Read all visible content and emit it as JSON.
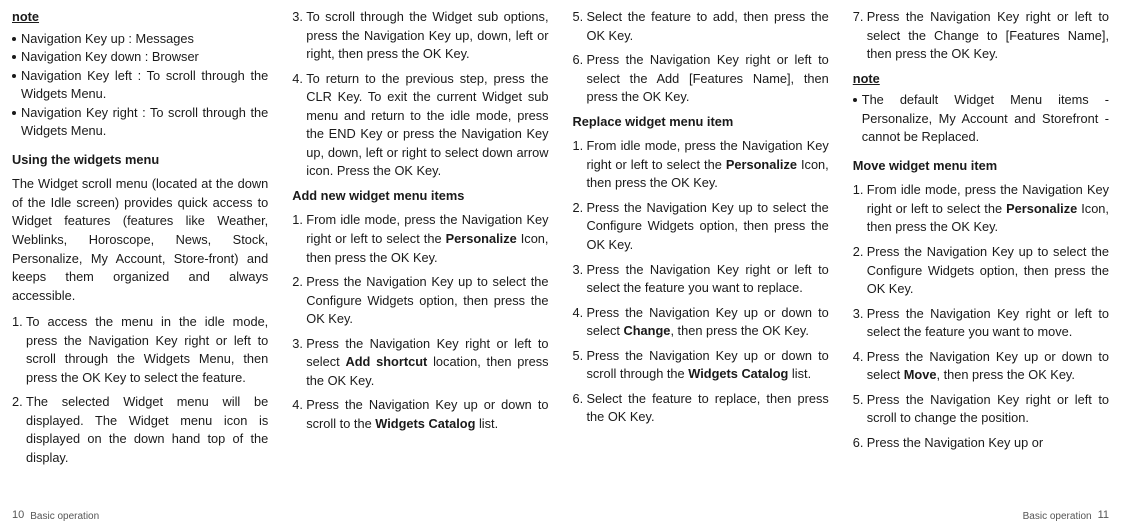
{
  "col1": {
    "note_heading": "note",
    "note_items": [
      "Navigation Key up : Messages",
      "Navigation Key down : Browser",
      "Navigation Key left : To scroll through the Widgets Menu.",
      "Navigation Key right : To scroll through the Widgets Menu."
    ],
    "sec_heading": "Using the widgets menu",
    "para": "The Widget scroll menu (located at the down of the Idle screen) provides quick access to Widget features (features like Weather, Weblinks, Horoscope, News, Stock, Personalize, My Account, Store-front) and keeps them organized and always accessible.",
    "steps": [
      "To access the menu in the idle mode, press the Navigation Key right or left to scroll through the Widgets Menu, then press the OK Key to select the feature.",
      "The selected Widget menu will be displayed. The Widget menu icon is displayed on the down hand top of the display."
    ],
    "footer_label": "Basic operation",
    "footer_num": "10"
  },
  "col2": {
    "top_steps": [
      "To scroll through the Widget sub options, press the Navigation Key up, down, left or right, then press the OK Key.",
      "To return to the previous step, press the CLR Key. To exit the current Widget sub menu and return to the idle mode, press the END Key or press the Navigation Key up, down, left or right to select down arrow icon. Press the OK Key."
    ],
    "sec_heading": "Add new widget menu items",
    "add_steps": {
      "s1a": "From idle mode, press the Navigation Key right or left to select the ",
      "s1b": "Personalize",
      "s1c": " Icon, then press the OK Key.",
      "s2": "Press the Navigation Key up to select the Configure Widgets option, then press the OK Key.",
      "s3a": "Press the Navigation Key right or left to select ",
      "s3b": "Add shortcut",
      "s3c": " location, then press the OK Key.",
      "s4a": "Press the Navigation Key up or down to scroll to the ",
      "s4b": "Widgets Catalog",
      "s4c": " list."
    }
  },
  "col3": {
    "top_steps": [
      "Select the feature to add, then press the OK Key.",
      "Press the Navigation Key right or left to select the Add [Features Name], then press the OK Key."
    ],
    "sec_heading": "Replace widget menu item",
    "rep_steps": {
      "s1a": "From idle mode, press the Navigation Key right or left to select the ",
      "s1b": "Personalize",
      "s1c": " Icon, then press the OK Key.",
      "s2": "Press the Navigation Key up to select the Configure Widgets option, then press the OK Key.",
      "s3": "Press the Navigation Key right or left to select the feature you want to replace.",
      "s4a": "Press the Navigation Key up or down to select ",
      "s4b": "Change",
      "s4c": ", then press the OK Key.",
      "s5a": "Press the Navigation Key up or down to scroll through the ",
      "s5b": "Widgets Catalog",
      "s5c": " list.",
      "s6": "Select the feature to replace, then press the OK Key."
    }
  },
  "col4": {
    "top_step": "Press the Navigation Key right or left to select the Change to [Features Name], then press the OK Key.",
    "note_heading": "note",
    "note_item": "The default Widget Menu items - Personalize, My Account and Storefront - cannot be Replaced.",
    "sec_heading": "Move widget menu item",
    "mov_steps": {
      "s1a": "From idle mode, press the Navigation Key right or left to select the ",
      "s1b": "Personalize",
      "s1c": " Icon, then press the OK Key.",
      "s2": "Press the Navigation Key up to select the Configure Widgets option, then press the OK Key.",
      "s3": "Press the Navigation Key right or left to select the feature you want to move.",
      "s4a": "Press the Navigation Key up or down to select ",
      "s4b": "Move",
      "s4c": ", then press the OK Key.",
      "s5": "Press the Navigation Key right or left to scroll to change the position.",
      "s6": "Press the Navigation Key up or"
    },
    "footer_label": "Basic operation",
    "footer_num": "11"
  }
}
